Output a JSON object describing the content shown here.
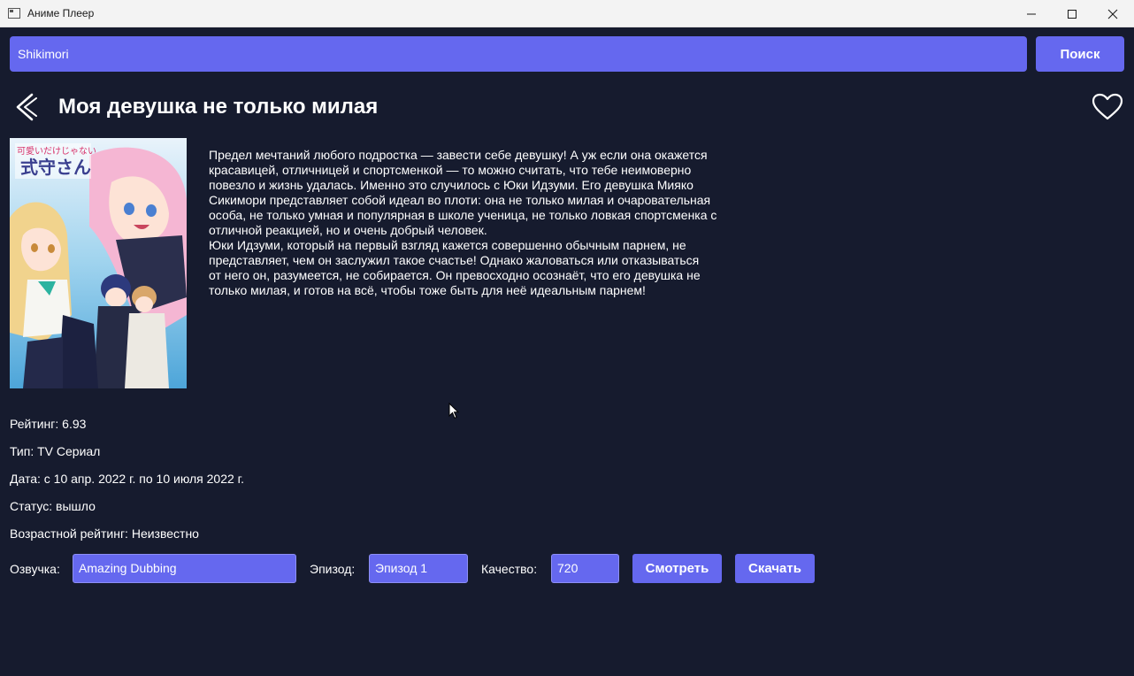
{
  "window": {
    "title": "Аниме Плеер",
    "minimize_icon": "minimize-icon",
    "maximize_icon": "maximize-icon",
    "close_icon": "close-icon"
  },
  "search": {
    "value": "Shikimori",
    "button_label": "Поиск"
  },
  "anime": {
    "title": "Моя девушка не только милая",
    "poster_logo_text": "可愛いだけじゃない式守さん",
    "description_lines_1": [
      "Предел мечтаний любого подростка — завести себе девушку! А уж если она окажется",
      "красавицей, отличницей и спортсменкой — то можно считать, что тебе неимоверно",
      "повезло и жизнь удалась. Именно это случилось с Юки Идзуми. Его девушка Мияко",
      "Сикимори представляет собой идеал во плоти: она не только милая и очаровательная",
      "особа, не только умная и популярная в школе ученица, не только ловкая спортсменка с",
      "отличной реакцией, но и очень добрый человек."
    ],
    "description_lines_2": [
      "Юки Идзуми, который на первый взгляд кажется совершенно обычным парнем, не",
      "представляет, чем он заслужил такое счастье! Однако жаловаться или отказываться",
      "от него он, разумеется, не собирается. Он превосходно осознаёт, что его девушка не",
      "только милая, и готов на всё, чтобы тоже быть для неё идеальным парнем!"
    ],
    "rating": "Рейтинг: 6.93",
    "type": "Тип: TV Сериал",
    "date": "Дата: с 10 апр. 2022 г. по 10 июля 2022 г.",
    "status": "Статус: вышло",
    "age_rating": "Возрастной рейтинг: Неизвестно"
  },
  "controls": {
    "voice_label": "Озвучка:",
    "voice_value": "Amazing Dubbing",
    "episode_label": "Эпизод:",
    "episode_value": "Эпизод 1",
    "quality_label": "Качество:",
    "quality_value": "720",
    "watch_label": "Смотреть",
    "download_label": "Скачать"
  },
  "colors": {
    "background": "#161b2e",
    "accent": "#6568ef",
    "text": "#ffffff"
  }
}
